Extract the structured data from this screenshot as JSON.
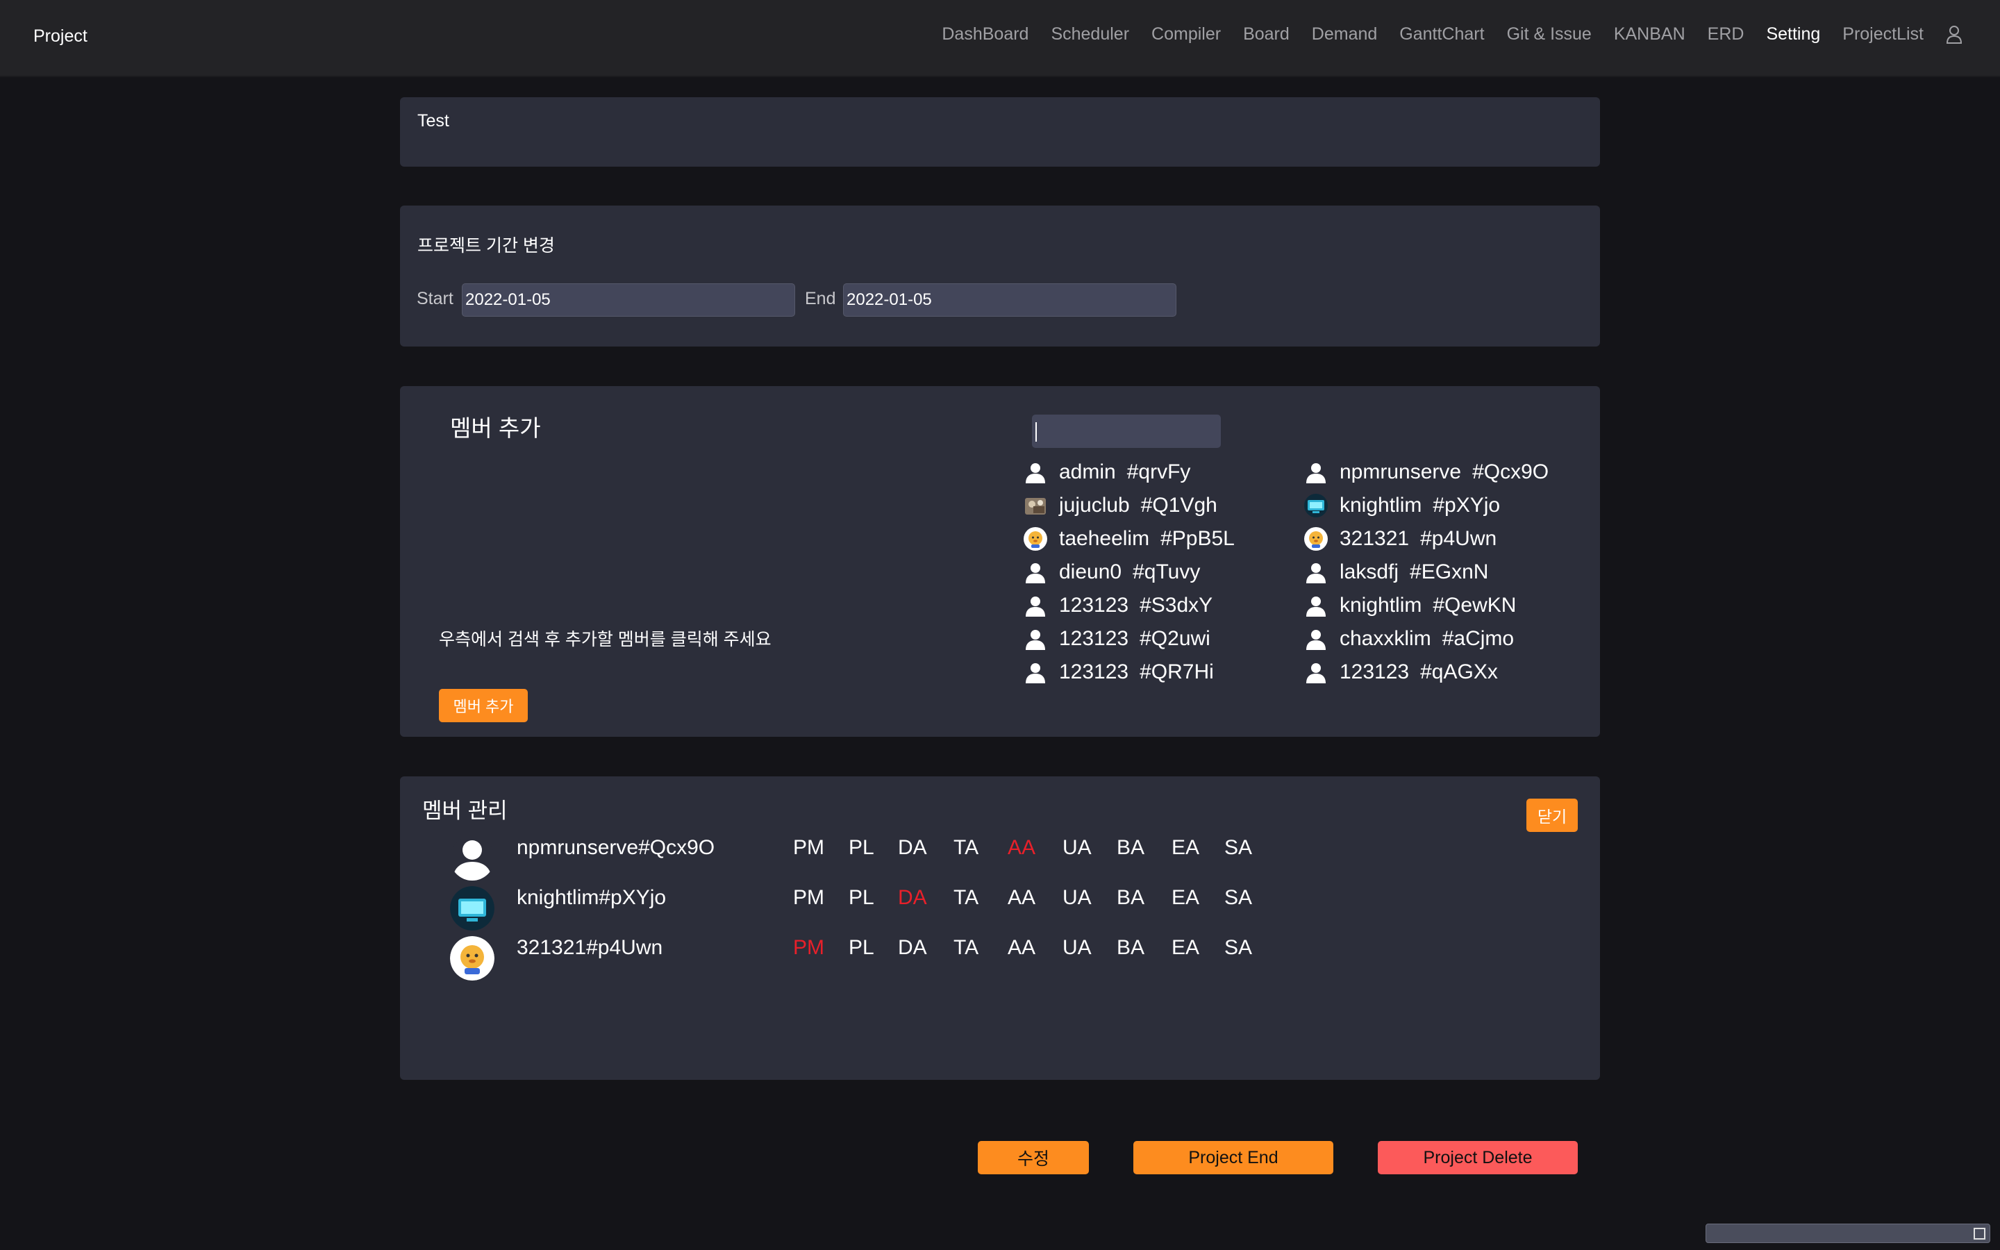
{
  "navbar": {
    "brand": "Project",
    "items": [
      "DashBoard",
      "Scheduler",
      "Compiler",
      "Board",
      "Demand",
      "GanttChart",
      "Git & Issue",
      "KANBAN",
      "ERD",
      "Setting",
      "ProjectList"
    ],
    "active": "Setting",
    "user_icon": "user-icon"
  },
  "project": {
    "name": "Test"
  },
  "period": {
    "title": "프로젝트 기간 변경",
    "start_label": "Start",
    "start_value": "2022-01-05",
    "end_label": "End",
    "end_value": "2022-01-05"
  },
  "add_member": {
    "title": "멤버 추가",
    "hint": "우측에서 검색 후 추가할 멤버를 클릭해 주세요",
    "button": "멤버 추가",
    "search_value": "",
    "results_left": [
      {
        "name": "admin",
        "tag": "#qrvFy",
        "avatar": "default"
      },
      {
        "name": "jujuclub",
        "tag": "#Q1Vgh",
        "avatar": "photo"
      },
      {
        "name": "taeheelim",
        "tag": "#PpB5L",
        "avatar": "character"
      },
      {
        "name": "dieun0",
        "tag": "#qTuvy",
        "avatar": "default"
      },
      {
        "name": "123123",
        "tag": "#S3dxY",
        "avatar": "default"
      },
      {
        "name": "123123",
        "tag": "#Q2uwi",
        "avatar": "default"
      },
      {
        "name": "123123",
        "tag": "#QR7Hi",
        "avatar": "default"
      }
    ],
    "results_right": [
      {
        "name": "npmrunserve",
        "tag": "#Qcx9O",
        "avatar": "default"
      },
      {
        "name": "knightlim",
        "tag": "#pXYjo",
        "avatar": "screen"
      },
      {
        "name": "321321",
        "tag": "#p4Uwn",
        "avatar": "character"
      },
      {
        "name": "laksdfj",
        "tag": "#EGxnN",
        "avatar": "default"
      },
      {
        "name": "knightlim",
        "tag": "#QewKN",
        "avatar": "default"
      },
      {
        "name": "chaxxklim",
        "tag": "#aCjmo",
        "avatar": "default"
      },
      {
        "name": "123123",
        "tag": "#qAGXx",
        "avatar": "default"
      }
    ]
  },
  "member_manage": {
    "title": "멤버 관리",
    "close_button": "닫기",
    "roles": [
      "PM",
      "PL",
      "DA",
      "TA",
      "AA",
      "UA",
      "BA",
      "EA",
      "SA"
    ],
    "members": [
      {
        "name": "npmrunserve#Qcx9O",
        "avatar": "default",
        "active_role": "AA"
      },
      {
        "name": "knightlim#pXYjo",
        "avatar": "screen",
        "active_role": "DA"
      },
      {
        "name": "321321#p4Uwn",
        "avatar": "character",
        "active_role": "PM"
      }
    ]
  },
  "actions": {
    "edit": "수정",
    "end": "Project End",
    "delete": "Project Delete"
  },
  "colors": {
    "accent": "#fd8c1f",
    "danger": "#fc5a5a",
    "role_active": "#e8202a",
    "card_bg": "#2c2e3a",
    "page_bg": "#141418"
  }
}
